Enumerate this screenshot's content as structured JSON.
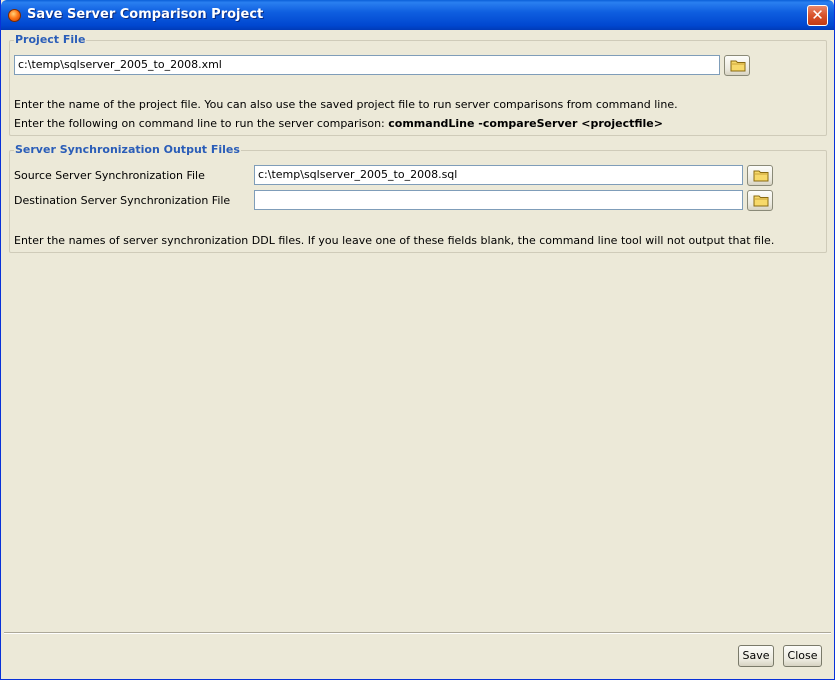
{
  "window": {
    "title": "Save Server Comparison Project"
  },
  "project_file": {
    "group_title": "Project File",
    "path_value": "c:\\temp\\sqlserver_2005_to_2008.xml",
    "help_line1": "Enter the name of the project file. You can also use the saved project file to run server comparisons from command line.",
    "help_line2_prefix": "Enter the following on command line to run the server comparison: ",
    "help_line2_command": "commandLine -compareServer <projectfile>"
  },
  "sync_output": {
    "group_title": "Server Synchronization Output Files",
    "source_label": "Source Server Synchronization File",
    "source_value": "c:\\temp\\sqlserver_2005_to_2008.sql",
    "dest_label": "Destination Server Synchronization File",
    "dest_value": "",
    "help_text": "Enter the names of server synchronization DDL files. If you leave one of these fields blank, the command line tool will not output that file."
  },
  "buttons": {
    "save": "Save",
    "close": "Close"
  },
  "icons": {
    "browse": "folder-icon",
    "app": "app-icon",
    "close": "close-icon"
  }
}
